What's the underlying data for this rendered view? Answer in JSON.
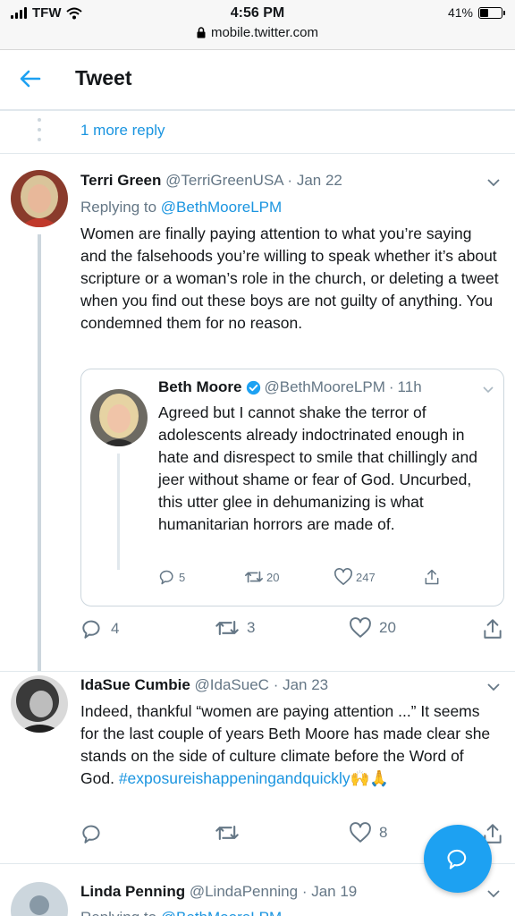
{
  "statusbar": {
    "carrier": "TFW",
    "time": "4:56 PM",
    "battery": "41%",
    "battery_level": 0.41,
    "url": "mobile.twitter.com"
  },
  "header": {
    "title": "Tweet",
    "back_icon": "arrow-left-icon"
  },
  "more_replies": {
    "label": "1 more reply"
  },
  "tweets": [
    {
      "name": "Terri Green",
      "handle": "@TerriGreenUSA",
      "separator": " · ",
      "date": "Jan 22",
      "replying_prefix": "Replying to",
      "replying_to": "@BethMooreLPM",
      "text": "Women are finally paying attention to what you’re saying and the falsehoods you’re willing to speak whether it’s about scripture or a woman’s role in the church, or deleting a tweet when you find out these boys are not guilty of anything. You condemned them for no reason.",
      "quote": {
        "name": "Beth Moore",
        "handle": "@BethMooreLPM",
        "separator": " · ",
        "time": "11h",
        "text": "Agreed but I cannot shake the terror of adolescents already indoctrinated enough in hate and disrespect to smile that chillingly and jeer without shame or fear of God. Uncurbed, this utter glee in dehumanizing is what humanitarian horrors are made of.",
        "replies": "5",
        "retweets": "20",
        "likes": "247"
      },
      "replies": "4",
      "retweets": "3",
      "likes": "20"
    },
    {
      "name": "IdaSue Cumbie",
      "handle": "@IdaSueC",
      "separator": " · ",
      "date": "Jan 23",
      "text": "Indeed, thankful “women are paying attention ...”  It seems for the last couple of years Beth Moore has made clear she stands on the side of culture climate before the Word of God.",
      "hashtag": "#exposureishappeningandquickly",
      "emoji": "🙌🙏",
      "replies": "",
      "retweets": "",
      "likes": "8"
    },
    {
      "name": "Linda Penning",
      "handle": "@LindaPenning",
      "separator": " · ",
      "date": "Jan 19",
      "replying_prefix": "Replying to",
      "replying_to": "@BethMooreLPM"
    }
  ],
  "colors": {
    "accent": "#1da1f2",
    "link": "#1b95e0",
    "muted": "#657786",
    "border": "#e1e8ed"
  },
  "icons": {
    "reply": "reply-icon",
    "retweet": "retweet-icon",
    "like": "heart-icon",
    "share": "share-icon",
    "compose": "compose-reply-icon"
  }
}
